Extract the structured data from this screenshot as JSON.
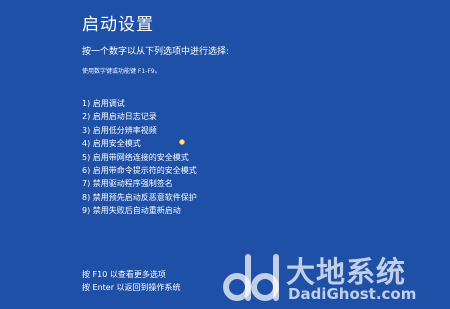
{
  "colors": {
    "background": "#1E50A8",
    "text": "#FFFFFF"
  },
  "title": "启动设置",
  "instruction": "按一个数字以从下列选项中进行选择:",
  "hint": "使用数字键或功能键 F1-F9。",
  "options": [
    {
      "label": "1) 启用调试"
    },
    {
      "label": "2) 启用启动日志记录"
    },
    {
      "label": "3) 启用低分辨率视频"
    },
    {
      "label": "4) 启用安全模式"
    },
    {
      "label": "5) 启用带网络连接的安全模式"
    },
    {
      "label": "6) 启用带命令提示符的安全模式"
    },
    {
      "label": "7) 禁用驱动程序强制签名"
    },
    {
      "label": "8) 禁用预先启动反恶意软件保护"
    },
    {
      "label": "9) 禁用失败后自动重新启动"
    }
  ],
  "footer": {
    "more_options": "按 F10 以查看更多选项",
    "return_to_os": "按 Enter 以返回到操作系统"
  },
  "watermark": {
    "cn": "大地系统",
    "en": "DadiGhost.com",
    "icon": "dd-logo-icon"
  },
  "pointer_icon": "mouse-pointer-icon"
}
